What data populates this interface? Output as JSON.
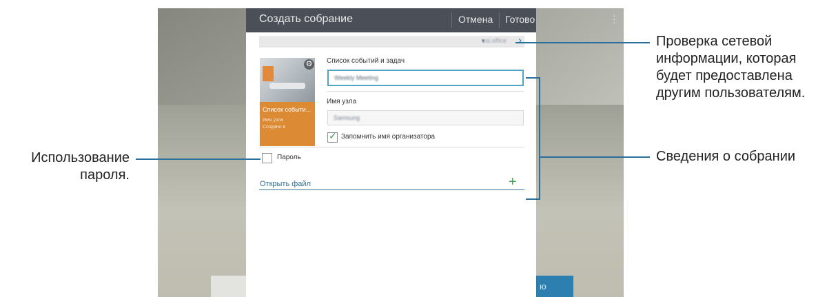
{
  "dialog": {
    "title": "Создать собрание",
    "cancel_label": "Отмена",
    "done_label": "Готово",
    "network_name": "ssi.office",
    "agenda_label": "Список событий и задач",
    "agenda_value": "Weekly Meeting",
    "host_label": "Имя узла",
    "host_value": "Samsung",
    "remember_label": "Запомнить имя организатора",
    "remember_checked": true,
    "password_label": "Пароль",
    "password_checked": false,
    "open_file_label": "Открыть файл",
    "thumbnail": {
      "title": "Список событи...",
      "host": "Имя узла",
      "created": "Создано в"
    }
  },
  "background": {
    "right_button_text": "ю"
  },
  "callouts": {
    "network_check_lines": [
      "Проверка сетевой",
      "информации, которая",
      "будет предоставлена",
      "другим пользователям."
    ],
    "password_use_lines": [
      "Использование",
      "пароля."
    ],
    "meeting_info": "Сведения о собрании"
  },
  "colors": {
    "accent_blue": "#2b6f9c",
    "title_bar": "#4b4f57",
    "check_green": "#3fa34d",
    "thumbnail_orange": "#dd8a35"
  },
  "icons": {
    "menu": "more-vert-icon",
    "network": "wifi-icon",
    "chevron": "chevron-right-icon",
    "gear": "gear-icon",
    "add": "plus-icon",
    "check": "checkmark-icon"
  }
}
